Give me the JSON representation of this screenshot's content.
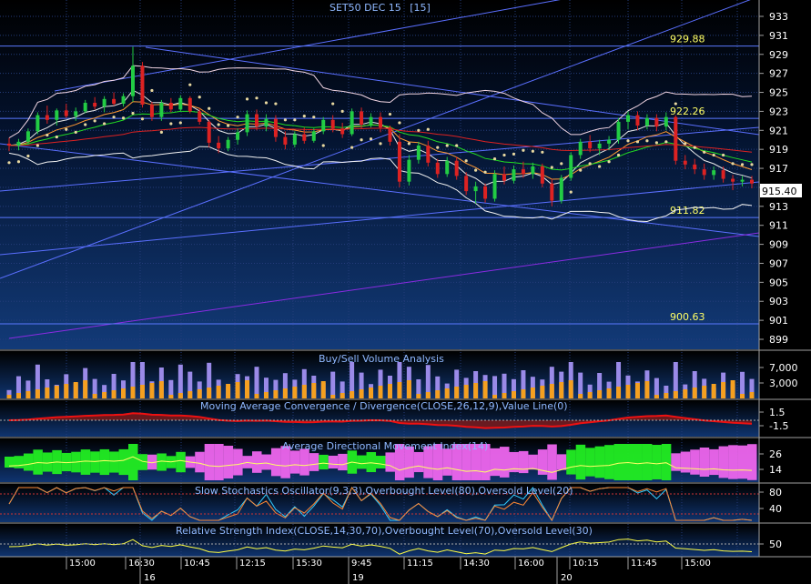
{
  "chart_data": {
    "type": "candlestick",
    "title": "SET50 DEC 15",
    "interval": "[15]",
    "last_price": "915.40",
    "ylim": [
      898,
      935
    ],
    "y_ticks": [
      "933",
      "931",
      "929",
      "927",
      "925",
      "923",
      "921",
      "919",
      "917",
      "915",
      "913",
      "911",
      "909",
      "907",
      "905",
      "903",
      "901",
      "899"
    ],
    "levels": [
      {
        "label": "929.88",
        "value": 929.88
      },
      {
        "label": "922.26",
        "value": 922.26
      },
      {
        "label": "911.82",
        "value": 911.82
      },
      {
        "label": "900.63",
        "value": 900.63
      }
    ],
    "time_ticks": [
      "15:00",
      "16:30",
      "10:45",
      "12:15",
      "15:30",
      "9:45",
      "11:15",
      "14:30",
      "16:00",
      "10:15",
      "11:45",
      "15:00"
    ],
    "date_ticks": [
      "16",
      "19",
      "20"
    ],
    "candles": [
      {
        "o": 919.6,
        "h": 920.2,
        "l": 918.8,
        "c": 919.4
      },
      {
        "o": 919.4,
        "h": 920.1,
        "l": 918.9,
        "c": 919.8
      },
      {
        "o": 919.8,
        "h": 921.2,
        "l": 919.5,
        "c": 920.9
      },
      {
        "o": 920.9,
        "h": 922.9,
        "l": 920.6,
        "c": 922.6
      },
      {
        "o": 922.6,
        "h": 923.6,
        "l": 921.7,
        "c": 922.1
      },
      {
        "o": 922.1,
        "h": 923.3,
        "l": 921.5,
        "c": 923.1
      },
      {
        "o": 923.1,
        "h": 923.8,
        "l": 922.3,
        "c": 922.5
      },
      {
        "o": 922.5,
        "h": 923.4,
        "l": 922.0,
        "c": 923.0
      },
      {
        "o": 923.0,
        "h": 924.2,
        "l": 922.8,
        "c": 923.9
      },
      {
        "o": 923.9,
        "h": 924.5,
        "l": 923.2,
        "c": 923.5
      },
      {
        "o": 923.5,
        "h": 924.6,
        "l": 922.9,
        "c": 924.3
      },
      {
        "o": 924.3,
        "h": 925.0,
        "l": 923.6,
        "c": 923.8
      },
      {
        "o": 923.8,
        "h": 924.9,
        "l": 923.5,
        "c": 924.6
      },
      {
        "o": 924.6,
        "h": 929.8,
        "l": 924.0,
        "c": 927.8
      },
      {
        "o": 927.8,
        "h": 928.2,
        "l": 923.4,
        "c": 923.7
      },
      {
        "o": 923.7,
        "h": 924.0,
        "l": 922.0,
        "c": 922.4
      },
      {
        "o": 922.4,
        "h": 924.2,
        "l": 922.0,
        "c": 923.9
      },
      {
        "o": 923.9,
        "h": 924.4,
        "l": 922.9,
        "c": 923.2
      },
      {
        "o": 923.2,
        "h": 924.7,
        "l": 923.0,
        "c": 924.4
      },
      {
        "o": 924.4,
        "h": 924.6,
        "l": 922.8,
        "c": 923.0
      },
      {
        "o": 923.0,
        "h": 923.3,
        "l": 921.6,
        "c": 921.9
      },
      {
        "o": 921.9,
        "h": 922.1,
        "l": 919.2,
        "c": 919.7
      },
      {
        "o": 919.7,
        "h": 920.4,
        "l": 918.6,
        "c": 919.1
      },
      {
        "o": 919.1,
        "h": 920.3,
        "l": 918.8,
        "c": 920.0
      },
      {
        "o": 920.0,
        "h": 921.2,
        "l": 919.5,
        "c": 920.8
      },
      {
        "o": 920.8,
        "h": 923.1,
        "l": 920.4,
        "c": 922.7
      },
      {
        "o": 922.7,
        "h": 923.2,
        "l": 921.0,
        "c": 921.4
      },
      {
        "o": 921.4,
        "h": 922.7,
        "l": 920.9,
        "c": 922.2
      },
      {
        "o": 922.2,
        "h": 922.6,
        "l": 919.8,
        "c": 920.3
      },
      {
        "o": 920.3,
        "h": 920.9,
        "l": 919.0,
        "c": 919.5
      },
      {
        "o": 919.5,
        "h": 920.9,
        "l": 919.2,
        "c": 920.6
      },
      {
        "o": 920.6,
        "h": 921.3,
        "l": 919.6,
        "c": 919.9
      },
      {
        "o": 919.9,
        "h": 921.2,
        "l": 919.7,
        "c": 920.9
      },
      {
        "o": 920.9,
        "h": 922.4,
        "l": 920.6,
        "c": 922.1
      },
      {
        "o": 922.1,
        "h": 922.6,
        "l": 920.8,
        "c": 921.2
      },
      {
        "o": 921.2,
        "h": 921.8,
        "l": 920.2,
        "c": 920.6
      },
      {
        "o": 920.6,
        "h": 923.3,
        "l": 920.4,
        "c": 923.0
      },
      {
        "o": 923.0,
        "h": 923.4,
        "l": 921.2,
        "c": 921.6
      },
      {
        "o": 921.6,
        "h": 922.8,
        "l": 921.3,
        "c": 922.4
      },
      {
        "o": 922.4,
        "h": 922.9,
        "l": 920.8,
        "c": 921.3
      },
      {
        "o": 921.3,
        "h": 921.5,
        "l": 919.4,
        "c": 919.8
      },
      {
        "o": 919.8,
        "h": 920.6,
        "l": 915.0,
        "c": 915.6
      },
      {
        "o": 915.6,
        "h": 918.4,
        "l": 915.2,
        "c": 917.9
      },
      {
        "o": 917.9,
        "h": 919.8,
        "l": 917.5,
        "c": 919.4
      },
      {
        "o": 919.4,
        "h": 919.9,
        "l": 917.2,
        "c": 917.6
      },
      {
        "o": 917.6,
        "h": 918.0,
        "l": 916.0,
        "c": 916.4
      },
      {
        "o": 916.4,
        "h": 918.2,
        "l": 916.1,
        "c": 917.8
      },
      {
        "o": 917.8,
        "h": 918.2,
        "l": 915.8,
        "c": 916.2
      },
      {
        "o": 916.2,
        "h": 916.6,
        "l": 914.2,
        "c": 914.6
      },
      {
        "o": 914.6,
        "h": 915.6,
        "l": 913.3,
        "c": 915.1
      },
      {
        "o": 915.1,
        "h": 915.4,
        "l": 913.4,
        "c": 913.8
      },
      {
        "o": 913.8,
        "h": 916.8,
        "l": 913.5,
        "c": 916.4
      },
      {
        "o": 916.4,
        "h": 917.2,
        "l": 915.3,
        "c": 915.7
      },
      {
        "o": 915.7,
        "h": 917.3,
        "l": 915.4,
        "c": 916.9
      },
      {
        "o": 916.9,
        "h": 917.7,
        "l": 916.0,
        "c": 916.4
      },
      {
        "o": 916.4,
        "h": 917.6,
        "l": 915.9,
        "c": 917.2
      },
      {
        "o": 917.2,
        "h": 917.5,
        "l": 915.0,
        "c": 915.4
      },
      {
        "o": 915.4,
        "h": 915.9,
        "l": 913.0,
        "c": 913.6
      },
      {
        "o": 913.6,
        "h": 916.3,
        "l": 913.3,
        "c": 916.0
      },
      {
        "o": 916.0,
        "h": 918.7,
        "l": 915.7,
        "c": 918.4
      },
      {
        "o": 918.4,
        "h": 920.1,
        "l": 918.0,
        "c": 919.8
      },
      {
        "o": 919.8,
        "h": 920.5,
        "l": 918.7,
        "c": 919.1
      },
      {
        "o": 919.1,
        "h": 920.0,
        "l": 918.4,
        "c": 919.6
      },
      {
        "o": 919.6,
        "h": 920.4,
        "l": 918.9,
        "c": 920.0
      },
      {
        "o": 920.0,
        "h": 922.3,
        "l": 919.6,
        "c": 921.9
      },
      {
        "o": 921.9,
        "h": 923.0,
        "l": 921.1,
        "c": 922.6
      },
      {
        "o": 922.6,
        "h": 923.0,
        "l": 921.0,
        "c": 921.5
      },
      {
        "o": 921.5,
        "h": 922.7,
        "l": 921.1,
        "c": 922.3
      },
      {
        "o": 922.3,
        "h": 922.7,
        "l": 920.9,
        "c": 921.4
      },
      {
        "o": 921.4,
        "h": 922.9,
        "l": 921.0,
        "c": 922.4
      },
      {
        "o": 922.4,
        "h": 922.6,
        "l": 917.4,
        "c": 917.8
      },
      {
        "o": 917.8,
        "h": 918.4,
        "l": 916.9,
        "c": 917.4
      },
      {
        "o": 917.4,
        "h": 918.0,
        "l": 916.4,
        "c": 916.9
      },
      {
        "o": 916.9,
        "h": 917.5,
        "l": 915.8,
        "c": 916.3
      },
      {
        "o": 916.3,
        "h": 917.2,
        "l": 915.8,
        "c": 916.8
      },
      {
        "o": 916.8,
        "h": 917.2,
        "l": 915.5,
        "c": 915.9
      },
      {
        "o": 915.9,
        "h": 916.3,
        "l": 914.7,
        "c": 915.6
      },
      {
        "o": 915.6,
        "h": 916.2,
        "l": 915.1,
        "c": 915.8
      },
      {
        "o": 915.8,
        "h": 916.2,
        "l": 914.9,
        "c": 915.4
      }
    ],
    "panels": [
      {
        "title": "Buy/Sell Volume Analysis",
        "y_ticks": [
          "7,000",
          "3,000"
        ]
      },
      {
        "title": "Moving Average Convergence / Divergence(CLOSE,26,12,9),Value Line(0)",
        "y_ticks": [
          "1.5",
          "-1.5"
        ]
      },
      {
        "title": "Average Directional Movement Index(14)",
        "y_ticks": [
          "26",
          "14"
        ]
      },
      {
        "title": "Slow Stochastics Oscillator(9,3,3),Overbought Level(80),Oversold Level(20)",
        "y_ticks": [
          "80",
          "40"
        ]
      },
      {
        "title": "Relative Strength Index(CLOSE,14,30,70),Overbought Level(70),Oversold Level(30)",
        "y_ticks": [
          "50"
        ]
      }
    ],
    "colors": {
      "up": "#22cc44",
      "down": "#dd2222",
      "background_top": "#000000",
      "background_bottom": "#123a78",
      "grid": "#243c7a",
      "level_line": "#5a78ff",
      "level_text": "#ffff66",
      "title_text": "#8fb8ff",
      "sar_dot": "#e8d8a0",
      "vol_buy": "#f5a020",
      "vol_sell": "#9a8ae8",
      "macd_pos": "#44ee22",
      "macd_neg": "#ee1111",
      "adx_green": "#22ee22",
      "adx_pink": "#ee66ee"
    }
  }
}
